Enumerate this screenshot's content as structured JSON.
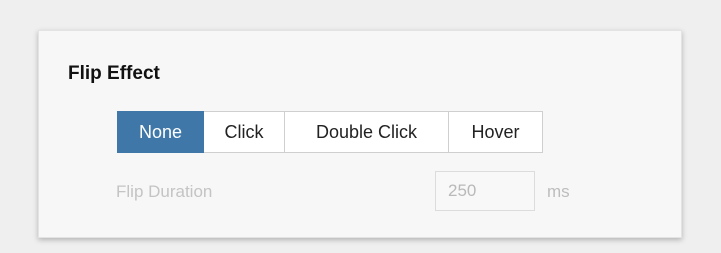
{
  "panel": {
    "title": "Flip Effect"
  },
  "flip_effect": {
    "options": [
      {
        "label": "None",
        "selected": true
      },
      {
        "label": "Click",
        "selected": false
      },
      {
        "label": "Double Click",
        "selected": false
      },
      {
        "label": "Hover",
        "selected": false
      }
    ]
  },
  "duration": {
    "label": "Flip Duration",
    "value": "250",
    "unit": "ms",
    "disabled": true
  },
  "colors": {
    "accent": "#3f78a8",
    "disabled_text": "#c4c4c4"
  }
}
